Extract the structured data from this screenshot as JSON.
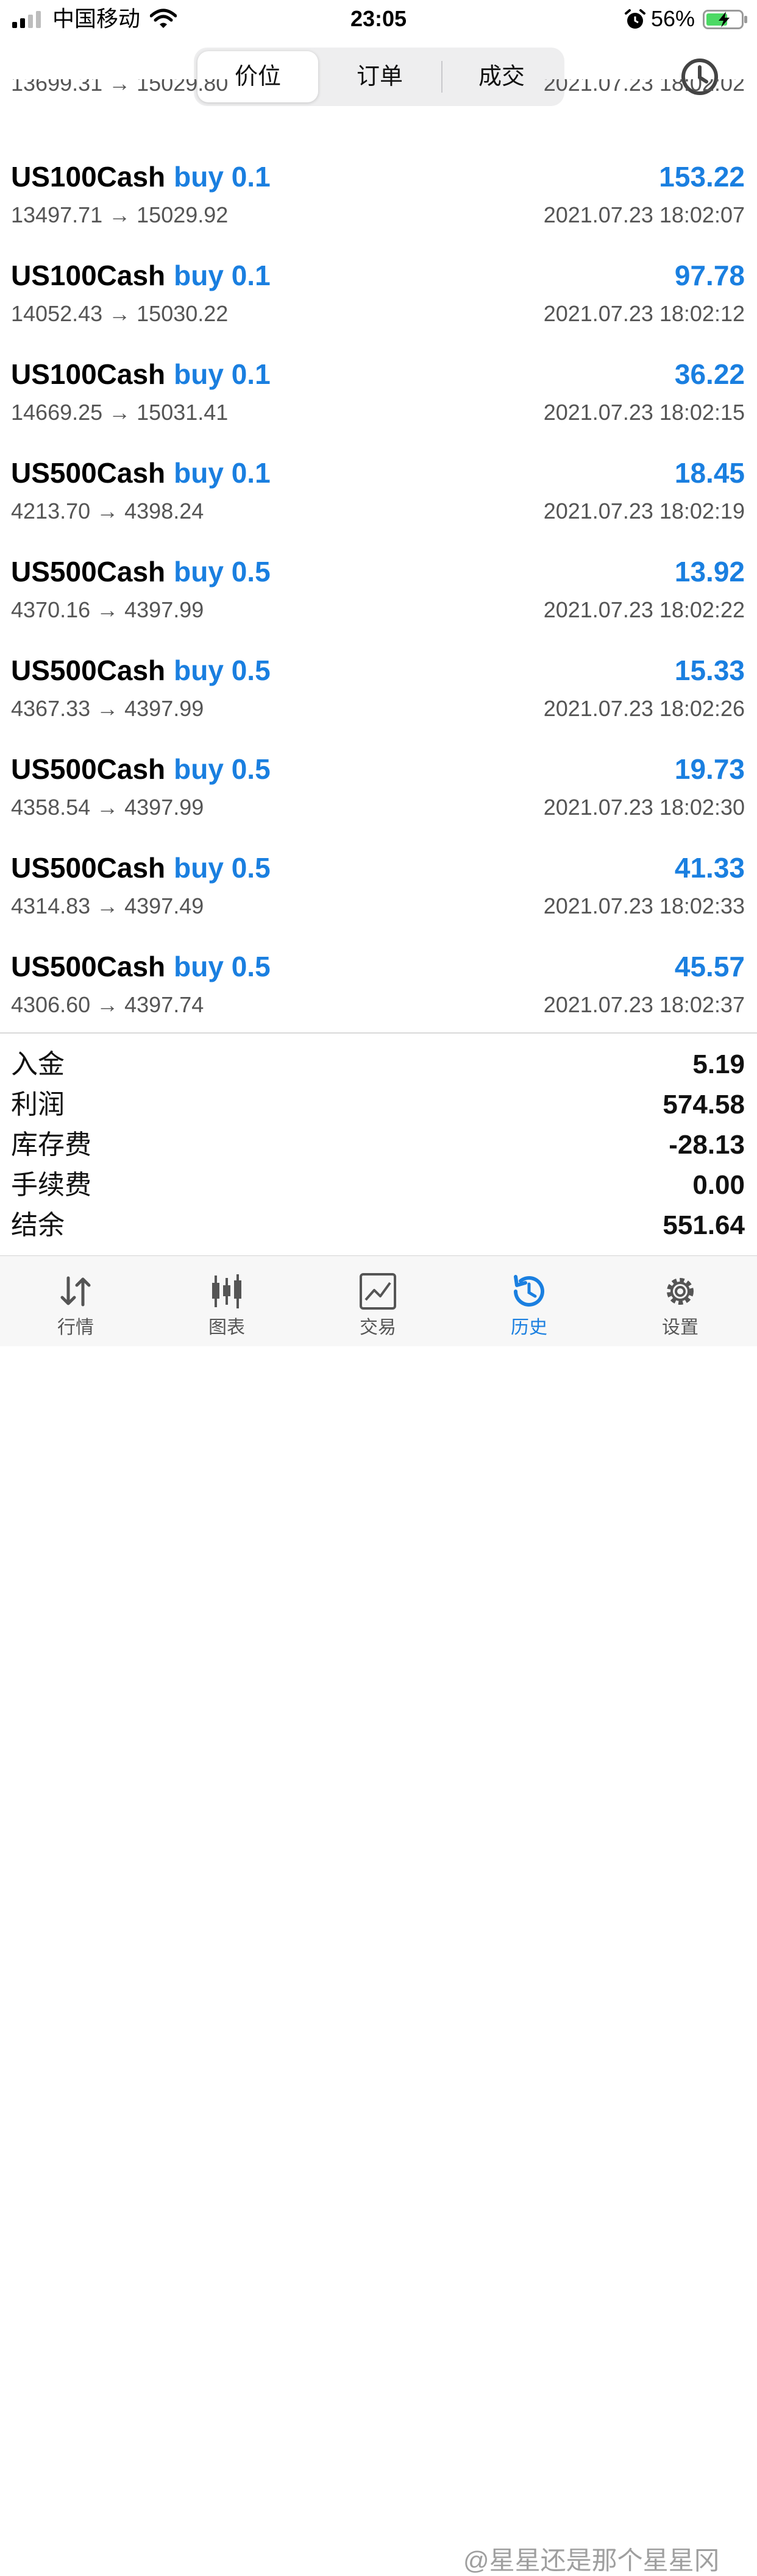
{
  "status_bar": {
    "carrier": "中国移动",
    "time": "23:05",
    "battery_percent": "56%"
  },
  "header": {
    "tabs": [
      {
        "label": "价位",
        "selected": true
      },
      {
        "label": "订单",
        "selected": false
      },
      {
        "label": "成交",
        "selected": false
      }
    ],
    "history_icon": "clock-icon"
  },
  "trades": [
    {
      "symbol": "US100Cash",
      "action": "buy 0.1",
      "profit": "153.22",
      "prices": "13497.71 → 15029.92",
      "time": "2021.07.23 18:02:07"
    },
    {
      "symbol": "US100Cash",
      "action": "buy 0.1",
      "profit": "97.78",
      "prices": "14052.43 → 15030.22",
      "time": "2021.07.23 18:02:12"
    },
    {
      "symbol": "US100Cash",
      "action": "buy 0.1",
      "profit": "36.22",
      "prices": "14669.25 → 15031.41",
      "time": "2021.07.23 18:02:15"
    },
    {
      "symbol": "US500Cash",
      "action": "buy 0.1",
      "profit": "18.45",
      "prices": "4213.70 → 4398.24",
      "time": "2021.07.23 18:02:19"
    },
    {
      "symbol": "US500Cash",
      "action": "buy 0.5",
      "profit": "13.92",
      "prices": "4370.16 → 4397.99",
      "time": "2021.07.23 18:02:22"
    },
    {
      "symbol": "US500Cash",
      "action": "buy 0.5",
      "profit": "15.33",
      "prices": "4367.33 → 4397.99",
      "time": "2021.07.23 18:02:26"
    },
    {
      "symbol": "US500Cash",
      "action": "buy 0.5",
      "profit": "19.73",
      "prices": "4358.54 → 4397.99",
      "time": "2021.07.23 18:02:30"
    },
    {
      "symbol": "US500Cash",
      "action": "buy 0.5",
      "profit": "41.33",
      "prices": "4314.83 → 4397.49",
      "time": "2021.07.23 18:02:33"
    },
    {
      "symbol": "US500Cash",
      "action": "buy 0.5",
      "profit": "45.57",
      "prices": "4306.60 → 4397.74",
      "time": "2021.07.23 18:02:37"
    }
  ],
  "summary": [
    {
      "label": "入金",
      "value": "5.19"
    },
    {
      "label": "利润",
      "value": "574.58"
    },
    {
      "label": "库存费",
      "value": "-28.13"
    },
    {
      "label": "手续费",
      "value": "0.00"
    },
    {
      "label": "结余",
      "value": "551.64"
    }
  ],
  "tabbar": [
    {
      "label": "行情",
      "icon": "arrows-updown-icon",
      "active": false
    },
    {
      "label": "图表",
      "icon": "candlestick-icon",
      "active": false
    },
    {
      "label": "交易",
      "icon": "line-chart-icon",
      "active": false
    },
    {
      "label": "历史",
      "icon": "history-clock-icon",
      "active": true
    },
    {
      "label": "设置",
      "icon": "gear-icon",
      "active": false
    }
  ],
  "watermark": "@星星还是那个星星冈",
  "colors": {
    "accent": "#1a7fe0",
    "text": "#000000",
    "secondary_text": "#555555"
  }
}
